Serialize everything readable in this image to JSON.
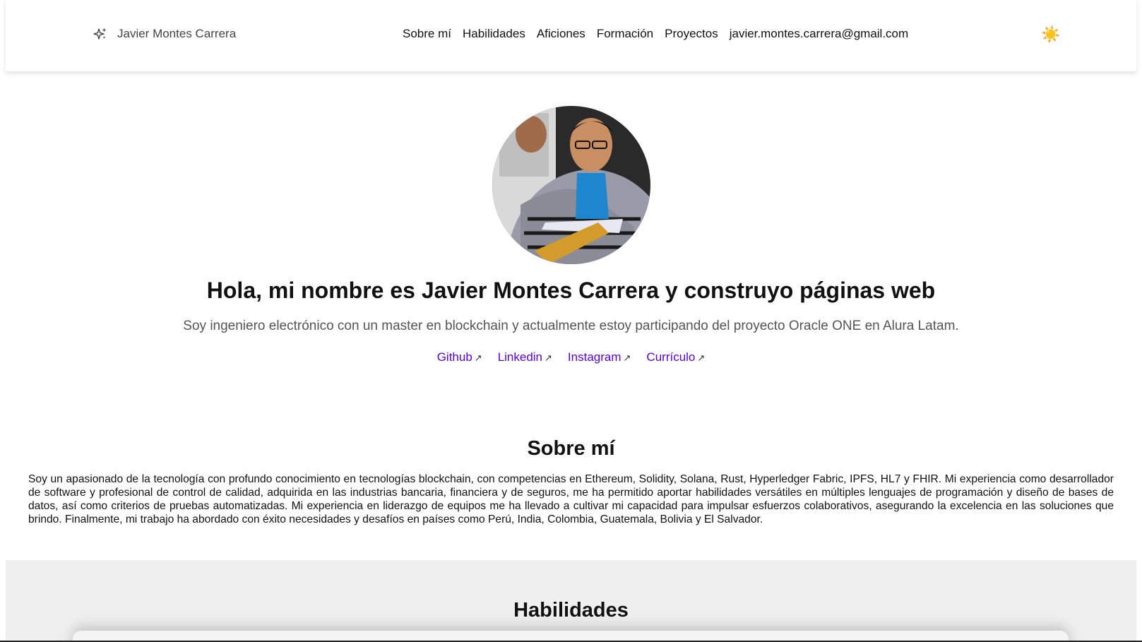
{
  "header": {
    "brand_icon": "sparkles-icon",
    "brand_name": "Javier Montes Carrera",
    "nav": [
      {
        "label": "Sobre mí"
      },
      {
        "label": "Habilidades"
      },
      {
        "label": "Aficiones"
      },
      {
        "label": "Formación"
      },
      {
        "label": "Proyectos"
      },
      {
        "label": "javier.montes.carrera@gmail.com"
      }
    ],
    "theme_toggle_icon": "sun-icon",
    "theme_toggle_glyph": "☀️"
  },
  "hero": {
    "title": "Hola, mi nombre es Javier Montes Carrera y construyo páginas web",
    "subtitle": "Soy ingeniero electrónico con un master en blockchain y actualmente estoy participando del proyecto Oracle ONE en Alura Latam.",
    "links": [
      {
        "label": "Github",
        "arrow": "↗"
      },
      {
        "label": "Linkedin",
        "arrow": "↗"
      },
      {
        "label": "Instagram",
        "arrow": "↗"
      },
      {
        "label": "Currículo",
        "arrow": "↗"
      }
    ],
    "link_color": "#5b00e0"
  },
  "about": {
    "title": "Sobre mí",
    "text": "Soy un apasionado de la tecnología con profundo conocimiento en tecnologías blockchain, con competencias en Ethereum, Solidity, Solana, Rust, Hyperledger Fabric, IPFS, HL7 y FHIR. Mi experiencia como desarrollador de software y profesional de control de calidad, adquirida en las industrias bancaria, financiera y de seguros, me ha permitido aportar habilidades versátiles en múltiples lenguajes de programación y diseño de bases de datos, así como criterios de pruebas automatizadas. Mi experiencia en liderazgo de equipos me ha llevado a cultivar mi capacidad para impulsar esfuerzos colaborativos, asegurando la excelencia en las soluciones que brindo. Finalmente, mi trabajo ha abordado con éxito necesidades y desafíos en países como Perú, India, Colombia, Guatemala, Bolivia y El Salvador."
  },
  "skills": {
    "title": "Habilidades",
    "background": "#efefef"
  }
}
